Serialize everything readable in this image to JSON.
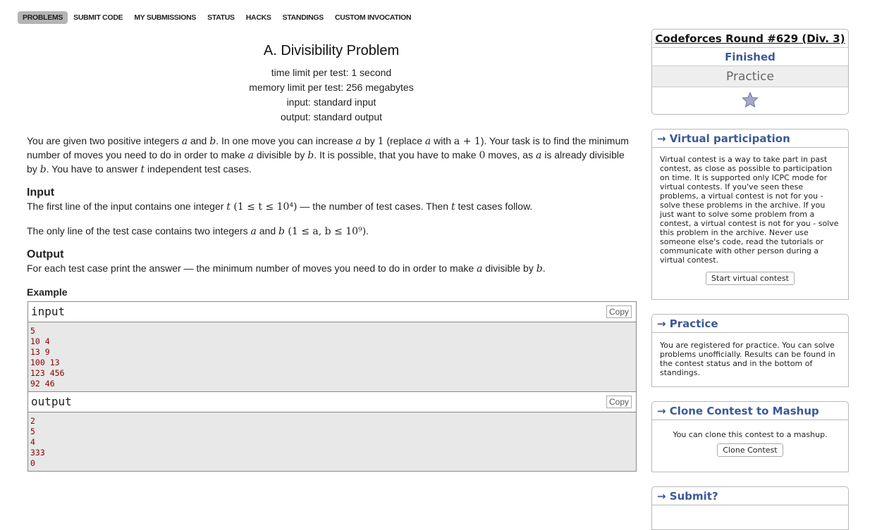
{
  "nav": {
    "items": [
      "PROBLEMS",
      "SUBMIT CODE",
      "MY SUBMISSIONS",
      "STATUS",
      "HACKS",
      "STANDINGS",
      "CUSTOM INVOCATION"
    ]
  },
  "problem": {
    "title": "A. Divisibility Problem",
    "time_limit": "time limit per test: 1 second",
    "memory_limit": "memory limit per test: 256 megabytes",
    "input": "input: standard input",
    "output": "output: standard output",
    "statement": {
      "t1": "You are given two positive integers ",
      "a1": "a",
      "t2": " and ",
      "b1": "b",
      "t3": ". In one move you can increase ",
      "a2": "a",
      "t4": " by ",
      "one": "1",
      "t5": " (replace ",
      "a3": "a",
      "t6": " with ",
      "a4": "a + 1",
      "t7": "). Your task is to find the minimum number of moves you need to do in order to make ",
      "a5": "a",
      "t8": " divisible by ",
      "b2": "b",
      "t9": ". It is possible, that you have to make ",
      "zero": "0",
      "t10": " moves, as ",
      "a6": "a",
      "t11": " is already divisible by ",
      "b3": "b",
      "t12": ". You have to answer ",
      "tvar": "t",
      "t13": " independent test cases."
    },
    "input_section": {
      "title": "Input",
      "p1_a": "The first line of the input contains one integer ",
      "p1_t": "t",
      "p1_math": " (1 ≤ t ≤ 10⁴)",
      "p1_b": " — the number of test cases. Then ",
      "p1_t2": "t",
      "p1_c": " test cases follow.",
      "p2_a": "The only line of the test case contains two integers ",
      "p2_av": "a",
      "p2_and": " and ",
      "p2_bv": "b",
      "p2_math": " (1 ≤ a, b ≤ 10⁹)",
      "p2_end": "."
    },
    "output_section": {
      "title": "Output",
      "p1_a": "For each test case print the answer — the minimum number of moves you need to do in order to make ",
      "p1_av": "a",
      "p1_b": " divisible by ",
      "p1_bv": "b",
      "p1_end": "."
    },
    "example": {
      "title": "Example",
      "input_label": "input",
      "output_label": "output",
      "copy_label": "Copy",
      "input_text": "5\n10 4\n13 9\n100 13\n123 456\n92 46",
      "output_text": "2\n5\n4\n333\n0"
    }
  },
  "sidebar": {
    "round": {
      "title": "Codeforces Round #629 (Div. 3)",
      "status": "Finished",
      "mode": "Practice",
      "star_icon": "star-icon"
    },
    "virtual": {
      "title": "→ Virtual participation",
      "text": "Virtual contest is a way to take part in past contest, as close as possible to participation on time. It is supported only ICPC mode for virtual contests. If you've seen these problems, a virtual contest is not for you - solve these problems in the archive. If you just want to solve some problem from a contest, a virtual contest is not for you - solve this problem in the archive. Never use someone else's code, read the tutorials or communicate with other person during a virtual contest.",
      "button": "Start virtual contest"
    },
    "practice": {
      "title": "→ Practice",
      "text": "You are registered for practice. You can solve problems unofficially. Results can be found in the contest status and in the bottom of standings."
    },
    "clone": {
      "title": "→ Clone Contest to Mashup",
      "text": "You can clone this contest to a mashup.",
      "button": "Clone Contest"
    },
    "submit": {
      "title": "→ Submit?"
    }
  },
  "colors": {
    "link_blue": "#3b5998",
    "example_text": "#8b0000",
    "nav_active_bg": "#b4b4b4"
  }
}
